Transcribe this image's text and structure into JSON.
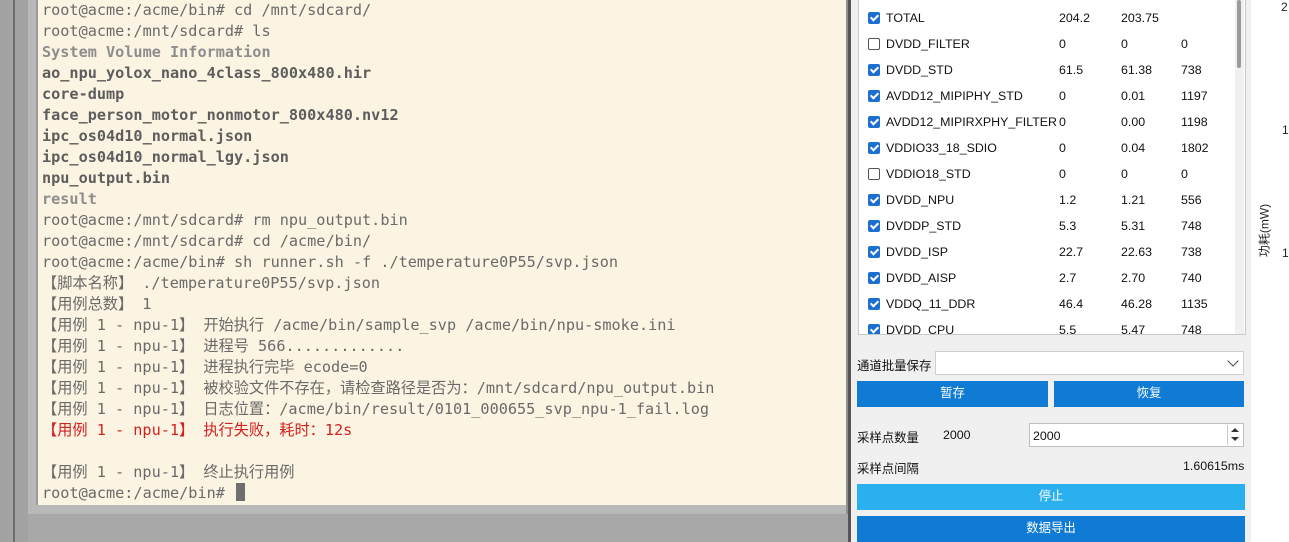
{
  "terminal": {
    "lines": [
      "root@acme:/acme/bin# cd /mnt/sdcard/",
      "root@acme:/mnt/sdcard# ls",
      "System Volume Information",
      "ao_npu_yolox_nano_4class_800x480.hir",
      "core-dump",
      "face_person_motor_nonmotor_800x480.nv12",
      "ipc_os04d10_normal.json",
      "ipc_os04d10_normal_lgy.json",
      "npu_output.bin",
      "result",
      "root@acme:/mnt/sdcard# rm npu_output.bin",
      "root@acme:/mnt/sdcard# cd /acme/bin/",
      "root@acme:/acme/bin# sh runner.sh -f ./temperature0P55/svp.json",
      "【脚本名称】 ./temperature0P55/svp.json",
      "【用例总数】 1",
      "【用例 1 - npu-1】 开始执行 /acme/bin/sample_svp /acme/bin/npu-smoke.ini",
      "【用例 1 - npu-1】 进程号 566.............",
      "【用例 1 - npu-1】 进程执行完毕 ecode=0",
      "【用例 1 - npu-1】 被校验文件不存在，请检查路径是否为：/mnt/sdcard/npu_output.bin",
      "【用例 1 - npu-1】 日志位置：/acme/bin/result/0101_000655_svp_npu-1_fail.log",
      "【用例 1 - npu-1】 执行失败，耗时：12s",
      "",
      "【用例 1 - npu-1】 终止执行用例",
      "root@acme:/acme/bin# "
    ]
  },
  "channels": [
    {
      "name": "TOTAL",
      "checked": true,
      "v1": "204.2",
      "v2": "203.75",
      "v3": ""
    },
    {
      "name": "DVDD_FILTER",
      "checked": false,
      "v1": "0",
      "v2": "0",
      "v3": "0"
    },
    {
      "name": "DVDD_STD",
      "checked": true,
      "v1": "61.5",
      "v2": "61.38",
      "v3": "738"
    },
    {
      "name": "AVDD12_MIPIPHY_STD",
      "checked": true,
      "v1": "0",
      "v2": "0.01",
      "v3": "1197"
    },
    {
      "name": "AVDD12_MIPIRXPHY_FILTER",
      "checked": true,
      "v1": "0",
      "v2": "0.00",
      "v3": "1198"
    },
    {
      "name": "VDDIO33_18_SDIO",
      "checked": true,
      "v1": "0",
      "v2": "0.04",
      "v3": "1802"
    },
    {
      "name": "VDDIO18_STD",
      "checked": false,
      "v1": "0",
      "v2": "0",
      "v3": "0"
    },
    {
      "name": "DVDD_NPU",
      "checked": true,
      "v1": "1.2",
      "v2": "1.21",
      "v3": "556"
    },
    {
      "name": "DVDDP_STD",
      "checked": true,
      "v1": "5.3",
      "v2": "5.31",
      "v3": "748"
    },
    {
      "name": "DVDD_ISP",
      "checked": true,
      "v1": "22.7",
      "v2": "22.63",
      "v3": "738"
    },
    {
      "name": "DVDD_AISP",
      "checked": true,
      "v1": "2.7",
      "v2": "2.70",
      "v3": "740"
    },
    {
      "name": "VDDQ_11_DDR",
      "checked": true,
      "v1": "46.4",
      "v2": "46.28",
      "v3": "1135"
    },
    {
      "name": "DVDD_CPU",
      "checked": true,
      "v1": "5.5",
      "v2": "5.47",
      "v3": "748"
    }
  ],
  "controls": {
    "preset_label": "通道批量保存",
    "preset_value": "",
    "pause_button": "暂存",
    "restore_button": "恢复",
    "sample_count_label": "采样点数量",
    "sample_count_value": "2000",
    "sample_count_input": "2000",
    "sample_interval_label": "采样点间隔",
    "sample_interval_value": "1.60615ms",
    "stop_button": "停止",
    "export_button": "数据导出"
  },
  "chart_axis": {
    "ylabel": "功耗(mW)",
    "ticks": [
      "2",
      "1",
      "1"
    ]
  },
  "colors": {
    "terminal_bg": "#fcf4e2",
    "error_text": "#d42020",
    "button_primary": "#0f7bd4",
    "button_stop": "#2ab0ef"
  }
}
